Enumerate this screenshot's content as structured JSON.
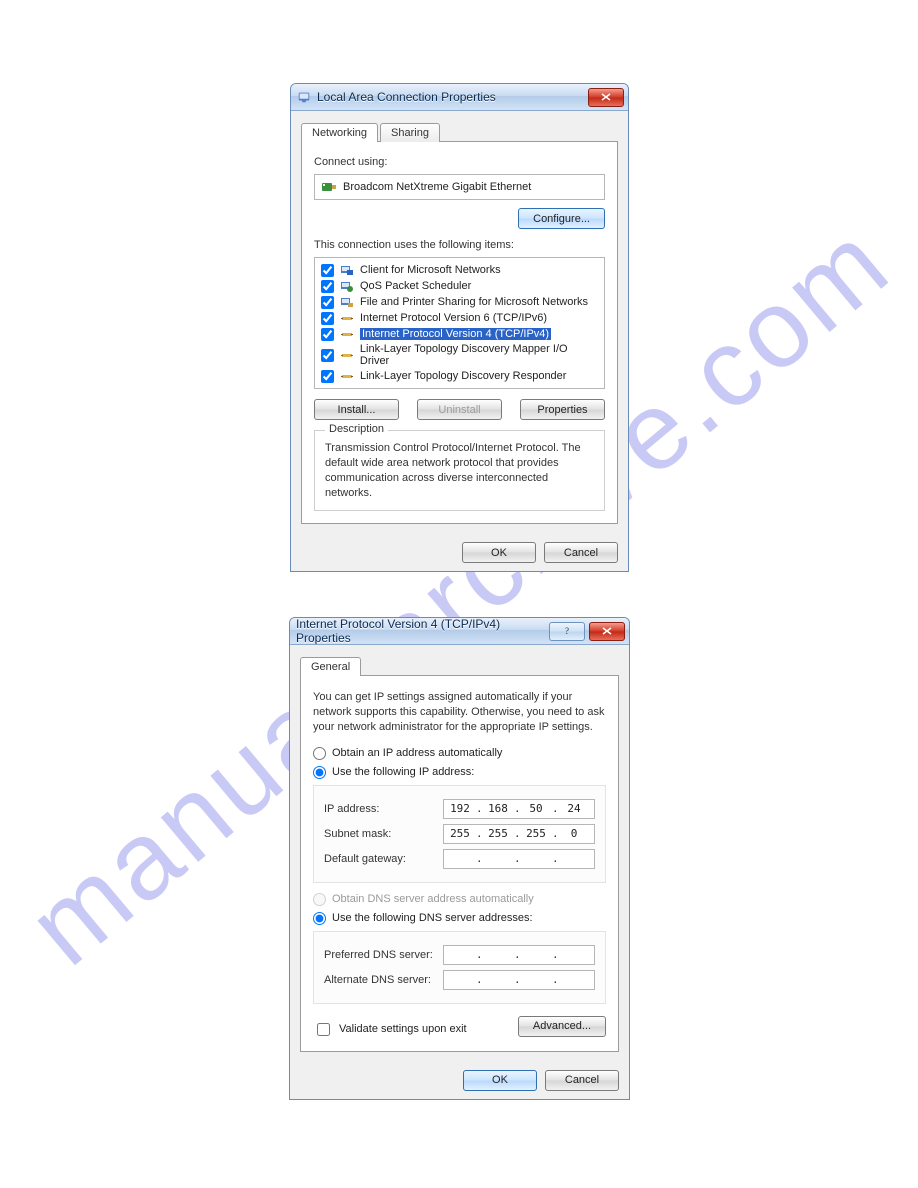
{
  "watermark": "manualsarchive.com",
  "dialog1": {
    "title": "Local Area Connection Properties",
    "tabs": {
      "networking": "Networking",
      "sharing": "Sharing"
    },
    "connect_using_label": "Connect using:",
    "adapter": "Broadcom NetXtreme Gigabit Ethernet",
    "configure_btn": "Configure...",
    "items_label": "This connection uses the following items:",
    "items": [
      {
        "label": "Client for Microsoft Networks",
        "checked": true,
        "icon": "client"
      },
      {
        "label": "QoS Packet Scheduler",
        "checked": true,
        "icon": "qos"
      },
      {
        "label": "File and Printer Sharing for Microsoft Networks",
        "checked": true,
        "icon": "share"
      },
      {
        "label": "Internet Protocol Version 6 (TCP/IPv6)",
        "checked": true,
        "icon": "proto"
      },
      {
        "label": "Internet Protocol Version 4 (TCP/IPv4)",
        "checked": true,
        "icon": "proto",
        "selected": true
      },
      {
        "label": "Link-Layer Topology Discovery Mapper I/O Driver",
        "checked": true,
        "icon": "proto"
      },
      {
        "label": "Link-Layer Topology Discovery Responder",
        "checked": true,
        "icon": "proto"
      }
    ],
    "install_btn": "Install...",
    "uninstall_btn": "Uninstall",
    "properties_btn": "Properties",
    "desc_title": "Description",
    "desc_text": "Transmission Control Protocol/Internet Protocol. The default wide area network protocol that provides communication across diverse interconnected networks.",
    "ok_btn": "OK",
    "cancel_btn": "Cancel"
  },
  "dialog2": {
    "title": "Internet Protocol Version 4 (TCP/IPv4) Properties",
    "tab": "General",
    "note": "You can get IP settings assigned automatically if your network supports this capability. Otherwise, you need to ask your network administrator for the appropriate IP settings.",
    "ip_auto": "Obtain an IP address automatically",
    "ip_manual": "Use the following IP address:",
    "ip_label": "IP address:",
    "ip_value": [
      "192",
      "168",
      "50",
      "24"
    ],
    "subnet_label": "Subnet mask:",
    "subnet_value": [
      "255",
      "255",
      "255",
      "0"
    ],
    "gateway_label": "Default gateway:",
    "gateway_value": [
      "",
      "",
      "",
      ""
    ],
    "dns_auto": "Obtain DNS server address automatically",
    "dns_manual": "Use the following DNS server addresses:",
    "pref_dns_label": "Preferred DNS server:",
    "pref_dns_value": [
      "",
      "",
      "",
      ""
    ],
    "alt_dns_label": "Alternate DNS server:",
    "alt_dns_value": [
      "",
      "",
      "",
      ""
    ],
    "validate_label": "Validate settings upon exit",
    "advanced_btn": "Advanced...",
    "ok_btn": "OK",
    "cancel_btn": "Cancel"
  }
}
